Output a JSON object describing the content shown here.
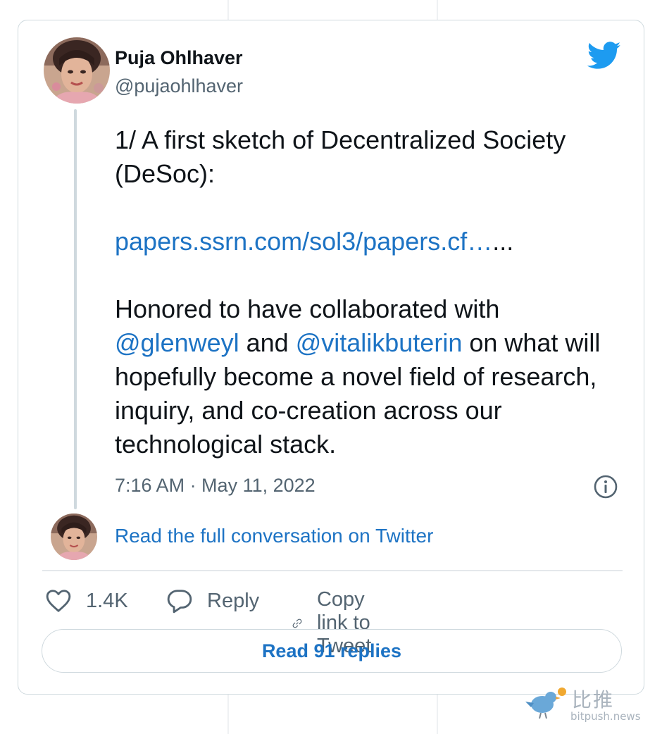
{
  "tweet": {
    "author_name": "Puja Ohlhaver",
    "author_handle": "@pujaohlhaver",
    "text_line1": "1/ A first sketch of Decentralized Society (DeSoc):",
    "link_text": "papers.ssrn.com/sol3/papers.cf…",
    "link_suffix": "...",
    "text_part1": "Honored to have collaborated with ",
    "mention1": "@glenweyl",
    "text_and": " and ",
    "mention2": "@vitalikbuterin",
    "text_part2": " on what will hopefully become a novel field of research, inquiry, and co-creation across our technological stack.",
    "timestamp": "7:16 AM · May 11, 2022"
  },
  "conversation": {
    "read_full_label": "Read the full conversation on Twitter"
  },
  "actions": {
    "likes_count": "1.4K",
    "reply_label": "Reply",
    "copy_link_label": "Copy link to Tweet"
  },
  "replies_button": {
    "label": "Read 91 replies"
  },
  "icons": {
    "brand": "twitter-bird-icon",
    "info": "info-icon",
    "like": "heart-icon",
    "reply": "speech-bubble-icon",
    "copy": "link-icon"
  },
  "watermark": {
    "brand_cn": "比推",
    "url": "bitpush.news"
  },
  "colors": {
    "link": "#1d73c4",
    "twitter_blue": "#1d9bf0",
    "secondary_text": "#536471",
    "border": "#cfd9de"
  }
}
